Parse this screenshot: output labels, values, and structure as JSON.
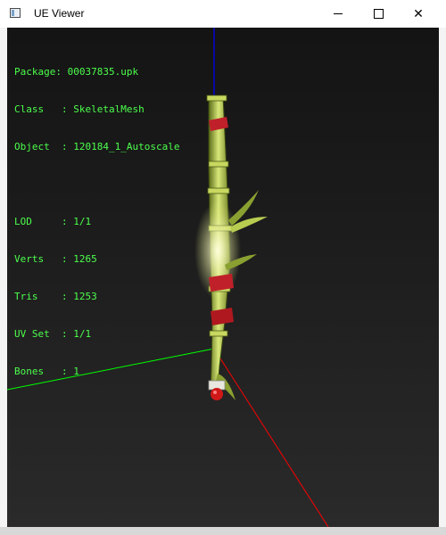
{
  "window": {
    "title": "UE Viewer",
    "controls": {
      "minimize": "minimize",
      "maximize": "maximize",
      "close": "✕"
    }
  },
  "info": {
    "package_label": "Package: ",
    "package_value": "00037835.upk",
    "class_label": "Class   : ",
    "class_value": "SkeletalMesh",
    "object_label": "Object  : ",
    "object_value": "120184_1_Autoscale",
    "lod_label": "LOD     : ",
    "lod_value": "1/1",
    "verts_label": "Verts   : ",
    "verts_value": "1265",
    "tris_label": "Tris    : ",
    "tris_value": "1253",
    "uvset_label": "UV Set  : ",
    "uvset_value": "1/1",
    "bones_label": "Bones   : ",
    "bones_value": "1"
  },
  "colors": {
    "info_text": "#4cff4c",
    "axis_x": "#ff0000",
    "axis_y": "#00ff00",
    "axis_z": "#0000ff",
    "bamboo": "#a8c03a",
    "ribbon": "#c0202a"
  }
}
